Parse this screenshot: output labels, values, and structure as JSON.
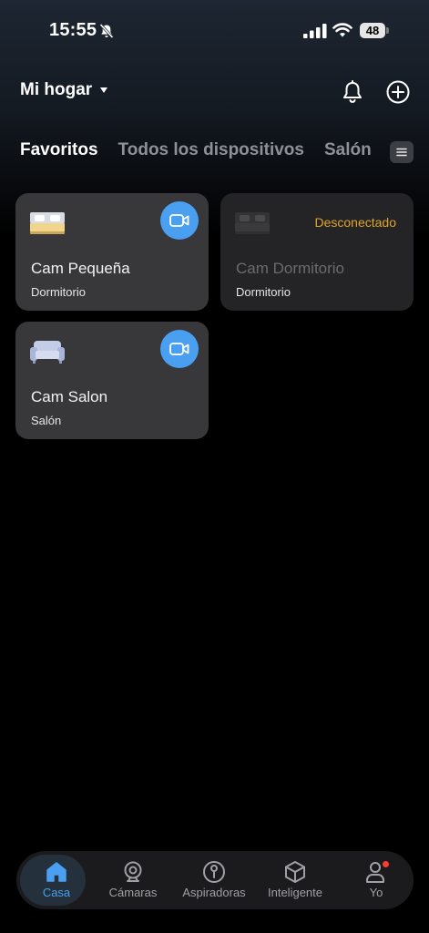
{
  "status_bar": {
    "time": "15:55",
    "battery": "48"
  },
  "header": {
    "home_name": "Mi hogar"
  },
  "tabs": [
    {
      "label": "Favoritos",
      "active": true
    },
    {
      "label": "Todos los dispositivos",
      "active": false
    },
    {
      "label": "Salón",
      "active": false
    }
  ],
  "devices": [
    {
      "name": "Cam Pequeña",
      "room": "Dormitorio",
      "status": ""
    },
    {
      "name": "Cam Dormitorio",
      "room": "Dormitorio",
      "status": "Desconectado"
    },
    {
      "name": "Cam Salon",
      "room": "Salón",
      "status": ""
    }
  ],
  "nav": {
    "items": [
      {
        "label": "Casa",
        "icon": "home-icon",
        "active": true
      },
      {
        "label": "Cámaras",
        "icon": "webcam-icon",
        "active": false
      },
      {
        "label": "Aspiradoras",
        "icon": "vacuum-icon",
        "active": false
      },
      {
        "label": "Inteligente",
        "icon": "cube-icon",
        "active": false
      },
      {
        "label": "Yo",
        "icon": "user-icon",
        "active": false
      }
    ]
  },
  "colors": {
    "accent": "#4a9ff0",
    "offline": "#e2a32b",
    "card": "#38383b",
    "badge": "#ff3b30"
  }
}
